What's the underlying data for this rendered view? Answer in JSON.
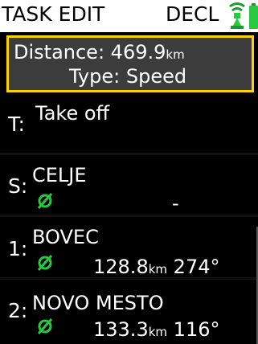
{
  "header": {
    "title": "TASK EDIT",
    "mode": "DECL",
    "antenna_icon": "antenna-icon",
    "battery_icon": "battery-icon",
    "accent_color": "#28c840"
  },
  "summary": {
    "distance_label": "Distance:",
    "distance_value": "469.9",
    "distance_unit": "km",
    "type_label": "Type:",
    "type_value": "Speed",
    "border_color": "#ffd300"
  },
  "turnpoints": [
    {
      "label": "T:",
      "name": "Take off"
    },
    {
      "label": "S:",
      "name": "CELJE",
      "icon": "no-zone-icon",
      "info": "-"
    },
    {
      "label": "1:",
      "name": "BOVEC",
      "icon": "no-zone-icon",
      "distance": "128.8",
      "unit": "km",
      "bearing": "274°"
    },
    {
      "label": "2:",
      "name": "NOVO MESTO",
      "icon": "no-zone-icon",
      "distance": "133.3",
      "unit": "km",
      "bearing": "116°"
    }
  ]
}
